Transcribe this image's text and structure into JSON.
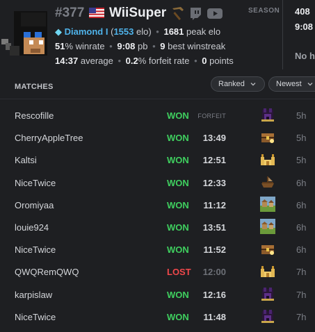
{
  "player": {
    "rank": "#377",
    "name": "WiiSuper",
    "tier_icon": "◆",
    "tier": "Diamond I",
    "elo_open": "(",
    "elo": "1553",
    "elo_suffix": " elo)",
    "peak_elo": "1681",
    "peak_label": " peak elo",
    "winrate": "51",
    "winrate_label": "% winrate",
    "pb": "9:08",
    "pb_label": " pb",
    "best_winstreak": "9",
    "winstreak_label": " best winstreak",
    "average": "14:37",
    "average_label": " average",
    "forfeit_rate": "0.2",
    "forfeit_label": "% forfeit rate",
    "points": "0",
    "points_label": " points"
  },
  "season": {
    "label": "SEASON",
    "value1": "408",
    "value2": "9:08",
    "value3": "No h"
  },
  "matches": {
    "title": "MATCHES",
    "filter1": "Ranked",
    "filter2": "Newest",
    "rows": [
      {
        "opponent": "Rescofille",
        "result": "WON",
        "time": "FORFEIT",
        "seed": "fortress",
        "ago": "5h"
      },
      {
        "opponent": "CherryAppleTree",
        "result": "WON",
        "time": "13:49",
        "seed": "buried-treasure",
        "ago": "5h"
      },
      {
        "opponent": "Kaltsi",
        "result": "WON",
        "time": "12:51",
        "seed": "desert-temple",
        "ago": "5h"
      },
      {
        "opponent": "NiceTwice",
        "result": "WON",
        "time": "12:33",
        "seed": "shipwreck",
        "ago": "6h"
      },
      {
        "opponent": "Oromiyaa",
        "result": "WON",
        "time": "11:12",
        "seed": "village",
        "ago": "6h"
      },
      {
        "opponent": "louie924",
        "result": "WON",
        "time": "13:51",
        "seed": "village",
        "ago": "6h"
      },
      {
        "opponent": "NiceTwice",
        "result": "WON",
        "time": "11:52",
        "seed": "buried-treasure",
        "ago": "6h"
      },
      {
        "opponent": "QWQRemQWQ",
        "result": "LOST",
        "time": "12:00",
        "seed": "desert-temple",
        "ago": "7h"
      },
      {
        "opponent": "karpislaw",
        "result": "WON",
        "time": "12:16",
        "seed": "fortress",
        "ago": "7h"
      },
      {
        "opponent": "NiceTwice",
        "result": "WON",
        "time": "11:48",
        "seed": "fortress",
        "ago": "7h"
      }
    ]
  },
  "colors": {
    "won": "#3fcf5f",
    "lost": "#f0484b",
    "diamond": "#4fb3ea",
    "background": "#1e1f22"
  }
}
